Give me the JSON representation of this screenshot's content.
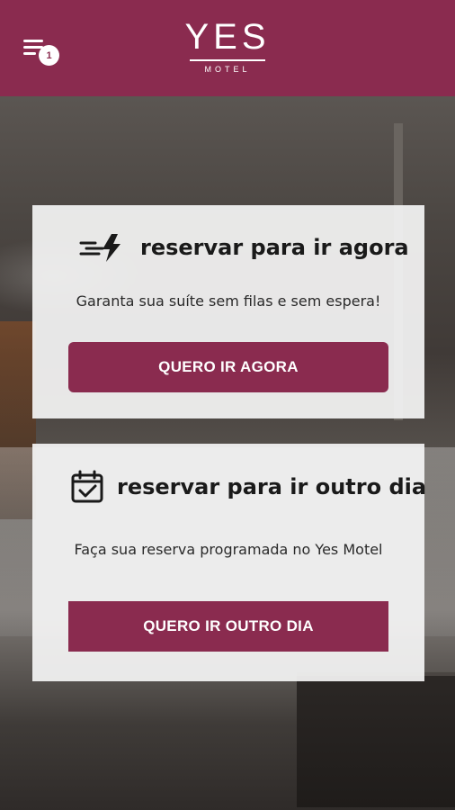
{
  "header": {
    "notification_count": "1",
    "logo_text": "YES",
    "logo_sub": "MOTEL",
    "background_color": "#8a2b4f"
  },
  "cards": [
    {
      "icon": "fast-lightning-icon",
      "title": "reservar para ir agora",
      "description": "Garanta sua suíte sem filas e sem espera!",
      "button_label": "QUERO IR AGORA"
    },
    {
      "icon": "calendar-check-icon",
      "title": "reservar para ir outro dia",
      "description": "Faça sua reserva programada no Yes Motel",
      "button_label": "QUERO IR OUTRO DIA"
    }
  ],
  "colors": {
    "accent": "#8a2b4f",
    "card_bg": "#f4f4f4"
  }
}
